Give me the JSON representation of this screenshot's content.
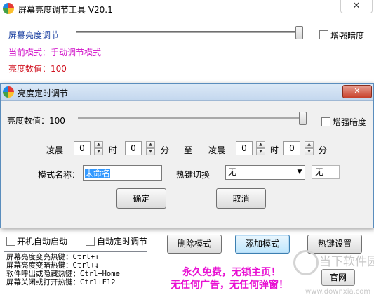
{
  "main": {
    "title": "屏幕亮度调节工具 V20.1",
    "close_glyph": "✕",
    "brightness_label": "屏幕亮度调节",
    "enhance_dark_label": "增强暗度",
    "mode_line": "当前模式：手动调节模式",
    "value_line": "亮度数值：100",
    "brightness_level": 100,
    "autostart_label": "开机自动启动",
    "auto_timer_label": "自动定时调节",
    "delete_mode_button": "删除模式",
    "add_mode_button": "添加模式",
    "hotkey_settings_button": "热键设置",
    "hotkey_lines": [
      "屏幕亮度变亮热键：Ctrl+↑",
      "屏幕亮度变暗热键：Ctrl+↓",
      "软件呼出或隐藏热键：Ctrl+Home",
      "屏幕关闭或打开热键：Ctrl+F12"
    ],
    "promo_line1": "永久免费，无锁主页！",
    "promo_line2": "无任何广告，无任何弹窗！",
    "official_site_button": "官网",
    "colors": {
      "promo": "#e80fd2",
      "mode": "#d010c8",
      "value": "#d0101e",
      "label": "#1a3fa0"
    }
  },
  "dialog": {
    "title": "亮度定时调节",
    "close_glyph": "✕",
    "value_label": "亮度数值：100",
    "brightness_level": 100,
    "enhance_dark_label": "增强暗度",
    "start_period": "凌晨",
    "start_hour": "0",
    "hour_unit": "时",
    "start_min": "0",
    "min_unit": "分",
    "to_label": "至",
    "end_period": "凌晨",
    "end_hour": "0",
    "end_min": "0",
    "mode_name_label": "模式名称：",
    "mode_name_value": "未命名",
    "hotkey_switch_label": "热键切换",
    "hotkey_select_value": "无",
    "hotkey_display": "无",
    "ok_button": "确定",
    "cancel_button": "取消"
  },
  "watermark": {
    "line1": "当下软件园",
    "line2": "www.downxia.com"
  }
}
